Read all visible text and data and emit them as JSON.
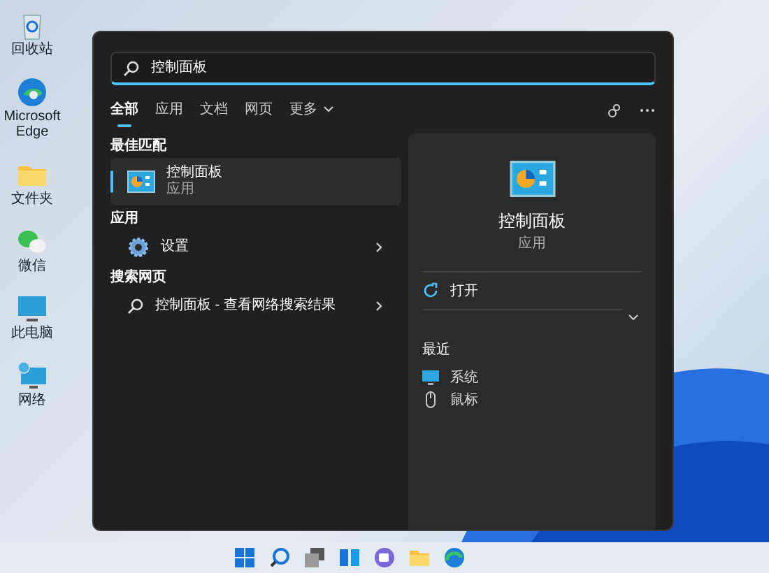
{
  "desktop_icons": [
    {
      "label": "回收站",
      "kind": "bin"
    },
    {
      "label": "Microsoft Edge",
      "kind": "browser"
    },
    {
      "label": "文件夹",
      "kind": "folder"
    },
    {
      "label": "微信",
      "kind": "chat"
    },
    {
      "label": "此电脑",
      "kind": "computer"
    },
    {
      "label": "网络",
      "kind": "network"
    }
  ],
  "search": {
    "value": "控制面板"
  },
  "tabs": [
    {
      "label": "全部",
      "selected": true,
      "has_menu": false
    },
    {
      "label": "应用",
      "selected": false,
      "has_menu": false
    },
    {
      "label": "文档",
      "selected": false,
      "has_menu": false
    },
    {
      "label": "网页",
      "selected": false,
      "has_menu": false
    },
    {
      "label": "更多",
      "selected": false,
      "has_menu": true
    }
  ],
  "sections": [
    {
      "heading": "最佳匹配",
      "items": [
        {
          "title": "控制面板",
          "subtitle": "应用",
          "kind": "panel",
          "selected": true,
          "has_arrow": false
        }
      ]
    },
    {
      "heading": "应用",
      "items": [
        {
          "title": "设置",
          "kind": "settings",
          "selected": false,
          "has_arrow": true
        }
      ]
    },
    {
      "heading": "搜索网页",
      "items": [
        {
          "title": "控制面板 - 查看网络搜索结果",
          "kind": "web",
          "selected": false,
          "has_arrow": true
        }
      ]
    }
  ],
  "preview": {
    "title": "控制面板",
    "subtitle": "应用",
    "actions": [
      {
        "label": "打开"
      }
    ],
    "recent_heading": "最近",
    "recent": [
      {
        "label": "系统",
        "kind": "system"
      },
      {
        "label": "鼠标",
        "kind": "mouse"
      }
    ]
  },
  "taskbar": [
    {
      "kind": "start"
    },
    {
      "kind": "search"
    },
    {
      "kind": "views"
    },
    {
      "kind": "widgets"
    },
    {
      "kind": "meet"
    },
    {
      "kind": "folder"
    },
    {
      "kind": "browser"
    }
  ]
}
